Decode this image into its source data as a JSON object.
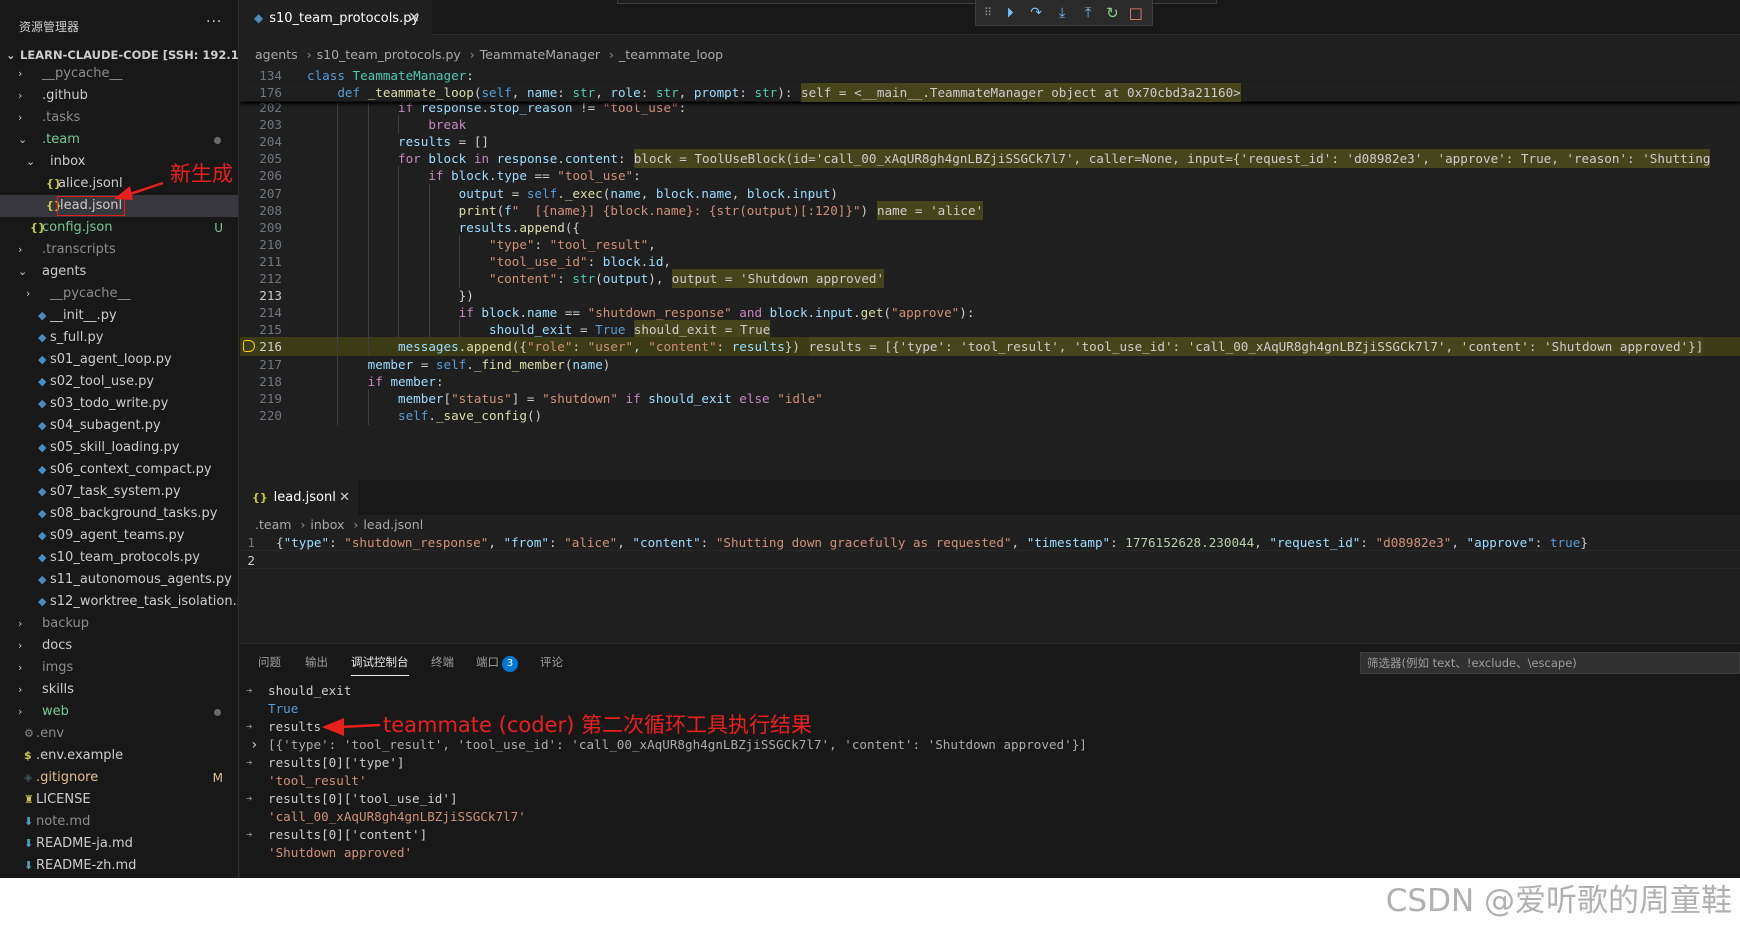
{
  "explorer": {
    "title": "资源管理器",
    "more": "···",
    "root": "LEARN-CLAUDE-CODE [SSH: 192.168.53....",
    "items": [
      {
        "label": "__pycache__",
        "type": "folder",
        "status": ""
      },
      {
        "label": ".github",
        "type": "folder",
        "status": ""
      },
      {
        "label": ".tasks",
        "type": "folder",
        "status": ""
      },
      {
        "label": ".team",
        "type": "folder-open",
        "status": "dot"
      },
      {
        "label": "inbox",
        "type": "folder-open",
        "status": ""
      },
      {
        "label": "alice.jsonl",
        "type": "json",
        "status": ""
      },
      {
        "label": "lead.jsonl",
        "type": "json",
        "status": ""
      },
      {
        "label": "config.json",
        "type": "json",
        "status": "U"
      },
      {
        "label": ".transcripts",
        "type": "folder",
        "status": ""
      },
      {
        "label": "agents",
        "type": "folder-open",
        "status": ""
      },
      {
        "label": "__pycache__",
        "type": "folder",
        "status": ""
      },
      {
        "label": "__init__.py",
        "type": "py",
        "status": ""
      },
      {
        "label": "s_full.py",
        "type": "py",
        "status": ""
      },
      {
        "label": "s01_agent_loop.py",
        "type": "py",
        "status": ""
      },
      {
        "label": "s02_tool_use.py",
        "type": "py",
        "status": ""
      },
      {
        "label": "s03_todo_write.py",
        "type": "py",
        "status": ""
      },
      {
        "label": "s04_subagent.py",
        "type": "py",
        "status": ""
      },
      {
        "label": "s05_skill_loading.py",
        "type": "py",
        "status": ""
      },
      {
        "label": "s06_context_compact.py",
        "type": "py",
        "status": ""
      },
      {
        "label": "s07_task_system.py",
        "type": "py",
        "status": ""
      },
      {
        "label": "s08_background_tasks.py",
        "type": "py",
        "status": ""
      },
      {
        "label": "s09_agent_teams.py",
        "type": "py",
        "status": ""
      },
      {
        "label": "s10_team_protocols.py",
        "type": "py",
        "status": ""
      },
      {
        "label": "s11_autonomous_agents.py",
        "type": "py",
        "status": ""
      },
      {
        "label": "s12_worktree_task_isolation.py",
        "type": "py",
        "status": ""
      },
      {
        "label": "backup",
        "type": "folder",
        "status": ""
      },
      {
        "label": "docs",
        "type": "folder",
        "status": ""
      },
      {
        "label": "imgs",
        "type": "folder",
        "status": ""
      },
      {
        "label": "skills",
        "type": "folder",
        "status": ""
      },
      {
        "label": "web",
        "type": "folder",
        "status": "dot"
      },
      {
        "label": ".env",
        "type": "gear",
        "status": ""
      },
      {
        "label": ".env.example",
        "type": "dollar",
        "status": ""
      },
      {
        "label": ".gitignore",
        "type": "git",
        "status": "M"
      },
      {
        "label": "LICENSE",
        "type": "license",
        "status": ""
      },
      {
        "label": "note.md",
        "type": "md",
        "status": ""
      },
      {
        "label": "README-ja.md",
        "type": "md",
        "status": ""
      },
      {
        "label": "README-zh.md",
        "type": "md",
        "status": ""
      }
    ]
  },
  "editor": {
    "tab_label": "s10_team_protocols.py",
    "breadcrumb": [
      "agents",
      "s10_team_protocols.py",
      "TeammateManager",
      "_teammate_loop"
    ],
    "sticky": [
      {
        "num": "134",
        "code": "class TeammateManager:"
      },
      {
        "num": "176",
        "code": "    def _teammate_loop(self, name: str, role: str, prompt: str):",
        "inline": "self = <__main__.TeammateManager object at 0x70cbd3a21160>"
      }
    ],
    "lines": [
      {
        "num": "202",
        "code": "            if response.stop_reason != \"tool_use\":"
      },
      {
        "num": "203",
        "code": "                break"
      },
      {
        "num": "204",
        "code": "            results = []"
      },
      {
        "num": "205",
        "code": "            for block in response.content:",
        "inline": "block = ToolUseBlock(id='call_00_xAqUR8gh4gnLBZjiSSGCk7l7', caller=None, input={'request_id': 'd08982e3', 'approve': True, 'reason': 'Shutting"
      },
      {
        "num": "206",
        "code": "                if block.type == \"tool_use\":"
      },
      {
        "num": "207",
        "code": "                    output = self._exec(name, block.name, block.input)"
      },
      {
        "num": "208",
        "code": "                    print(f\"  [{name}] {block.name}: {str(output)[:120]}\")",
        "inline": "name = 'alice'"
      },
      {
        "num": "209",
        "code": "                    results.append({"
      },
      {
        "num": "210",
        "code": "                        \"type\": \"tool_result\","
      },
      {
        "num": "211",
        "code": "                        \"tool_use_id\": block.id,"
      },
      {
        "num": "212",
        "code": "                        \"content\": str(output),",
        "inline": "output = 'Shutdown approved'"
      },
      {
        "num": "213",
        "code": "                    })"
      },
      {
        "num": "214",
        "code": "                    if block.name == \"shutdown_response\" and block.input.get(\"approve\"):"
      },
      {
        "num": "215",
        "code": "                        should_exit = True",
        "inline": "should_exit = True"
      },
      {
        "num": "216",
        "code": "            messages.append({\"role\": \"user\", \"content\": results})",
        "inline": "results = [{'type': 'tool_result', 'tool_use_id': 'call_00_xAqUR8gh4gnLBZjiSSGCk7l7', 'content': 'Shutdown approved'}]"
      },
      {
        "num": "217",
        "code": "        member = self._find_member(name)"
      },
      {
        "num": "218",
        "code": "        if member:"
      },
      {
        "num": "219",
        "code": "            member[\"status\"] = \"shutdown\" if should_exit else \"idle\""
      },
      {
        "num": "220",
        "code": "            self._save_config()"
      }
    ]
  },
  "editor2": {
    "tab_label": "lead.jsonl",
    "breadcrumb": [
      ".team",
      "inbox",
      "lead.jsonl"
    ],
    "lines": [
      {
        "num": "1",
        "code": "{\"type\": \"shutdown_response\", \"from\": \"alice\", \"content\": \"Shutting down gracefully as requested\", \"timestamp\": 1776152628.230044, \"request_id\": \"d08982e3\", \"approve\": true}"
      },
      {
        "num": "2",
        "code": ""
      }
    ]
  },
  "panel": {
    "tabs": [
      "问题",
      "输出",
      "调试控制台",
      "终端",
      "端口",
      "评论"
    ],
    "ports_badge": "3",
    "filter_placeholder": "筛选器(例如 text、!exclude、\\escape)",
    "console": [
      {
        "kind": "in",
        "text": "should_exit"
      },
      {
        "kind": "out-kw",
        "text": "True"
      },
      {
        "kind": "in",
        "text": "results"
      },
      {
        "kind": "out-expand",
        "text": "[{'type': 'tool_result', 'tool_use_id': 'call_00_xAqUR8gh4gnLBZjiSSGCk7l7', 'content': 'Shutdown approved'}]"
      },
      {
        "kind": "in",
        "text": "results[0]['type']"
      },
      {
        "kind": "out-str",
        "text": "'tool_result'"
      },
      {
        "kind": "in",
        "text": "results[0]['tool_use_id']"
      },
      {
        "kind": "out-str",
        "text": "'call_00_xAqUR8gh4gnLBZjiSSGCk7l7'"
      },
      {
        "kind": "in",
        "text": "results[0]['content']"
      },
      {
        "kind": "out-str",
        "text": "'Shutdown approved'"
      }
    ]
  },
  "annotations": {
    "new_file": "新生成",
    "results_note": "teammate (coder) 第二次循环工具执行结果"
  },
  "watermark": "CSDN @爱听歌的周童鞋"
}
